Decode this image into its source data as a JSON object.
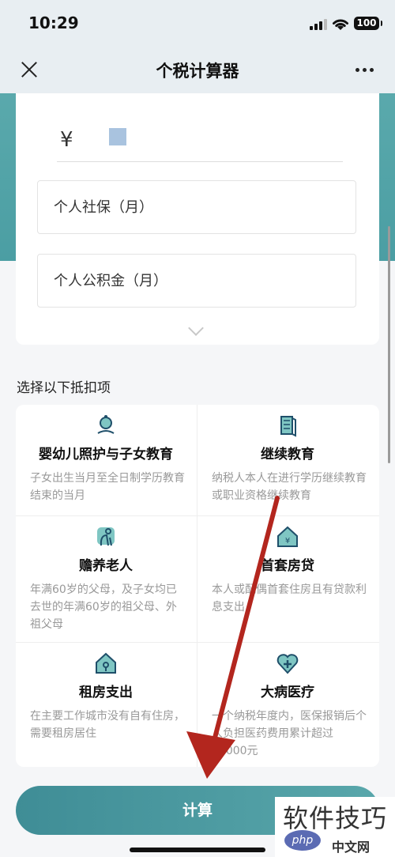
{
  "status": {
    "time": "10:29",
    "battery": "100"
  },
  "nav": {
    "title": "个税计算器"
  },
  "form": {
    "currency_symbol": "¥",
    "social_security_placeholder": "个人社保（月）",
    "housing_fund_placeholder": "个人公积金（月）"
  },
  "deductions": {
    "section_title": "选择以下抵扣项",
    "items": [
      {
        "title": "婴幼儿照护与子女教育",
        "desc": "子女出生当月至全日制学历教育结束的当月",
        "icon": "child-care-icon"
      },
      {
        "title": "继续教育",
        "desc": "纳税人本人在进行学历继续教育或职业资格继续教育",
        "icon": "book-icon"
      },
      {
        "title": "赡养老人",
        "desc": "年满60岁的父母，及子女均已去世的年满60岁的祖父母、外祖父母",
        "icon": "elder-icon"
      },
      {
        "title": "首套房贷",
        "desc": "本人或配偶首套住房且有贷款利息支出",
        "icon": "house-loan-icon"
      },
      {
        "title": "租房支出",
        "desc": "在主要工作城市没有自有住房，需要租房居住",
        "icon": "rent-icon"
      },
      {
        "title": "大病医疗",
        "desc": "一个纳税年度内，医保报销后个人负担医药费用累计超过15000元",
        "icon": "medical-icon"
      }
    ]
  },
  "actions": {
    "calculate_label": "计算"
  },
  "watermark": {
    "text": "软件技巧",
    "php": "php",
    "site": "中文网"
  },
  "colors": {
    "accent": "#4b9ea3",
    "annotation": "#b3261e"
  }
}
